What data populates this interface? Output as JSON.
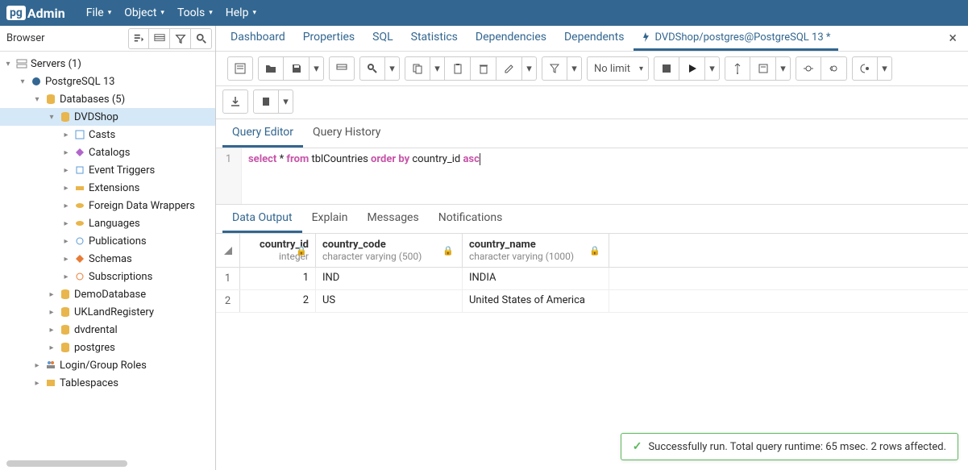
{
  "topmenu": [
    "File",
    "Object",
    "Tools",
    "Help"
  ],
  "browser_title": "Browser",
  "tree": {
    "servers": "Servers (1)",
    "pg13": "PostgreSQL 13",
    "databases": "Databases (5)",
    "dvdshop": "DVDShop",
    "dvdshop_children": [
      "Casts",
      "Catalogs",
      "Event Triggers",
      "Extensions",
      "Foreign Data Wrappers",
      "Languages",
      "Publications",
      "Schemas",
      "Subscriptions"
    ],
    "other_dbs": [
      "DemoDatabase",
      "UKLandRegistery",
      "dvdrental",
      "postgres"
    ],
    "login_roles": "Login/Group Roles",
    "tablespaces": "Tablespaces"
  },
  "tabs": [
    "Dashboard",
    "Properties",
    "SQL",
    "Statistics",
    "Dependencies",
    "Dependents"
  ],
  "query_tab": "DVDShop/postgres@PostgreSQL 13 *",
  "limit": "No limit",
  "editor_tabs": [
    "Query Editor",
    "Query History"
  ],
  "line_no": "1",
  "sql": {
    "kw1": "select",
    "star": " * ",
    "kw2": "from",
    "tbl": " tblCountries ",
    "kw3": "order by",
    "col": " country_id ",
    "kw4": "asc"
  },
  "result_tabs": [
    "Data Output",
    "Explain",
    "Messages",
    "Notifications"
  ],
  "columns": [
    {
      "name": "country_id",
      "type": "integer"
    },
    {
      "name": "country_code",
      "type": "character varying (500)"
    },
    {
      "name": "country_name",
      "type": "character varying (1000)"
    }
  ],
  "rows": [
    {
      "n": "1",
      "id": "1",
      "code": "IND",
      "name": "INDIA"
    },
    {
      "n": "2",
      "id": "2",
      "code": "US",
      "name": "United States of America"
    }
  ],
  "status": "Successfully run. Total query runtime: 65 msec. 2 rows affected."
}
